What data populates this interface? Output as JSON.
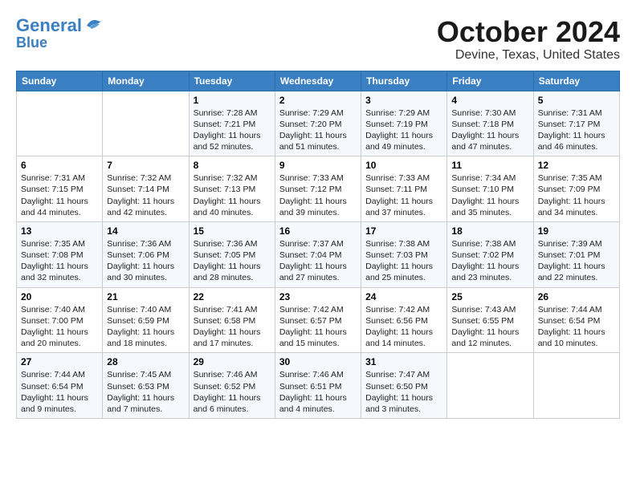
{
  "header": {
    "logo_line1": "General",
    "logo_line2": "Blue",
    "month": "October 2024",
    "location": "Devine, Texas, United States"
  },
  "days_of_week": [
    "Sunday",
    "Monday",
    "Tuesday",
    "Wednesday",
    "Thursday",
    "Friday",
    "Saturday"
  ],
  "weeks": [
    [
      {
        "day": "",
        "info": ""
      },
      {
        "day": "",
        "info": ""
      },
      {
        "day": "1",
        "info": "Sunrise: 7:28 AM\nSunset: 7:21 PM\nDaylight: 11 hours and 52 minutes."
      },
      {
        "day": "2",
        "info": "Sunrise: 7:29 AM\nSunset: 7:20 PM\nDaylight: 11 hours and 51 minutes."
      },
      {
        "day": "3",
        "info": "Sunrise: 7:29 AM\nSunset: 7:19 PM\nDaylight: 11 hours and 49 minutes."
      },
      {
        "day": "4",
        "info": "Sunrise: 7:30 AM\nSunset: 7:18 PM\nDaylight: 11 hours and 47 minutes."
      },
      {
        "day": "5",
        "info": "Sunrise: 7:31 AM\nSunset: 7:17 PM\nDaylight: 11 hours and 46 minutes."
      }
    ],
    [
      {
        "day": "6",
        "info": "Sunrise: 7:31 AM\nSunset: 7:15 PM\nDaylight: 11 hours and 44 minutes."
      },
      {
        "day": "7",
        "info": "Sunrise: 7:32 AM\nSunset: 7:14 PM\nDaylight: 11 hours and 42 minutes."
      },
      {
        "day": "8",
        "info": "Sunrise: 7:32 AM\nSunset: 7:13 PM\nDaylight: 11 hours and 40 minutes."
      },
      {
        "day": "9",
        "info": "Sunrise: 7:33 AM\nSunset: 7:12 PM\nDaylight: 11 hours and 39 minutes."
      },
      {
        "day": "10",
        "info": "Sunrise: 7:33 AM\nSunset: 7:11 PM\nDaylight: 11 hours and 37 minutes."
      },
      {
        "day": "11",
        "info": "Sunrise: 7:34 AM\nSunset: 7:10 PM\nDaylight: 11 hours and 35 minutes."
      },
      {
        "day": "12",
        "info": "Sunrise: 7:35 AM\nSunset: 7:09 PM\nDaylight: 11 hours and 34 minutes."
      }
    ],
    [
      {
        "day": "13",
        "info": "Sunrise: 7:35 AM\nSunset: 7:08 PM\nDaylight: 11 hours and 32 minutes."
      },
      {
        "day": "14",
        "info": "Sunrise: 7:36 AM\nSunset: 7:06 PM\nDaylight: 11 hours and 30 minutes."
      },
      {
        "day": "15",
        "info": "Sunrise: 7:36 AM\nSunset: 7:05 PM\nDaylight: 11 hours and 28 minutes."
      },
      {
        "day": "16",
        "info": "Sunrise: 7:37 AM\nSunset: 7:04 PM\nDaylight: 11 hours and 27 minutes."
      },
      {
        "day": "17",
        "info": "Sunrise: 7:38 AM\nSunset: 7:03 PM\nDaylight: 11 hours and 25 minutes."
      },
      {
        "day": "18",
        "info": "Sunrise: 7:38 AM\nSunset: 7:02 PM\nDaylight: 11 hours and 23 minutes."
      },
      {
        "day": "19",
        "info": "Sunrise: 7:39 AM\nSunset: 7:01 PM\nDaylight: 11 hours and 22 minutes."
      }
    ],
    [
      {
        "day": "20",
        "info": "Sunrise: 7:40 AM\nSunset: 7:00 PM\nDaylight: 11 hours and 20 minutes."
      },
      {
        "day": "21",
        "info": "Sunrise: 7:40 AM\nSunset: 6:59 PM\nDaylight: 11 hours and 18 minutes."
      },
      {
        "day": "22",
        "info": "Sunrise: 7:41 AM\nSunset: 6:58 PM\nDaylight: 11 hours and 17 minutes."
      },
      {
        "day": "23",
        "info": "Sunrise: 7:42 AM\nSunset: 6:57 PM\nDaylight: 11 hours and 15 minutes."
      },
      {
        "day": "24",
        "info": "Sunrise: 7:42 AM\nSunset: 6:56 PM\nDaylight: 11 hours and 14 minutes."
      },
      {
        "day": "25",
        "info": "Sunrise: 7:43 AM\nSunset: 6:55 PM\nDaylight: 11 hours and 12 minutes."
      },
      {
        "day": "26",
        "info": "Sunrise: 7:44 AM\nSunset: 6:54 PM\nDaylight: 11 hours and 10 minutes."
      }
    ],
    [
      {
        "day": "27",
        "info": "Sunrise: 7:44 AM\nSunset: 6:54 PM\nDaylight: 11 hours and 9 minutes."
      },
      {
        "day": "28",
        "info": "Sunrise: 7:45 AM\nSunset: 6:53 PM\nDaylight: 11 hours and 7 minutes."
      },
      {
        "day": "29",
        "info": "Sunrise: 7:46 AM\nSunset: 6:52 PM\nDaylight: 11 hours and 6 minutes."
      },
      {
        "day": "30",
        "info": "Sunrise: 7:46 AM\nSunset: 6:51 PM\nDaylight: 11 hours and 4 minutes."
      },
      {
        "day": "31",
        "info": "Sunrise: 7:47 AM\nSunset: 6:50 PM\nDaylight: 11 hours and 3 minutes."
      },
      {
        "day": "",
        "info": ""
      },
      {
        "day": "",
        "info": ""
      }
    ]
  ]
}
